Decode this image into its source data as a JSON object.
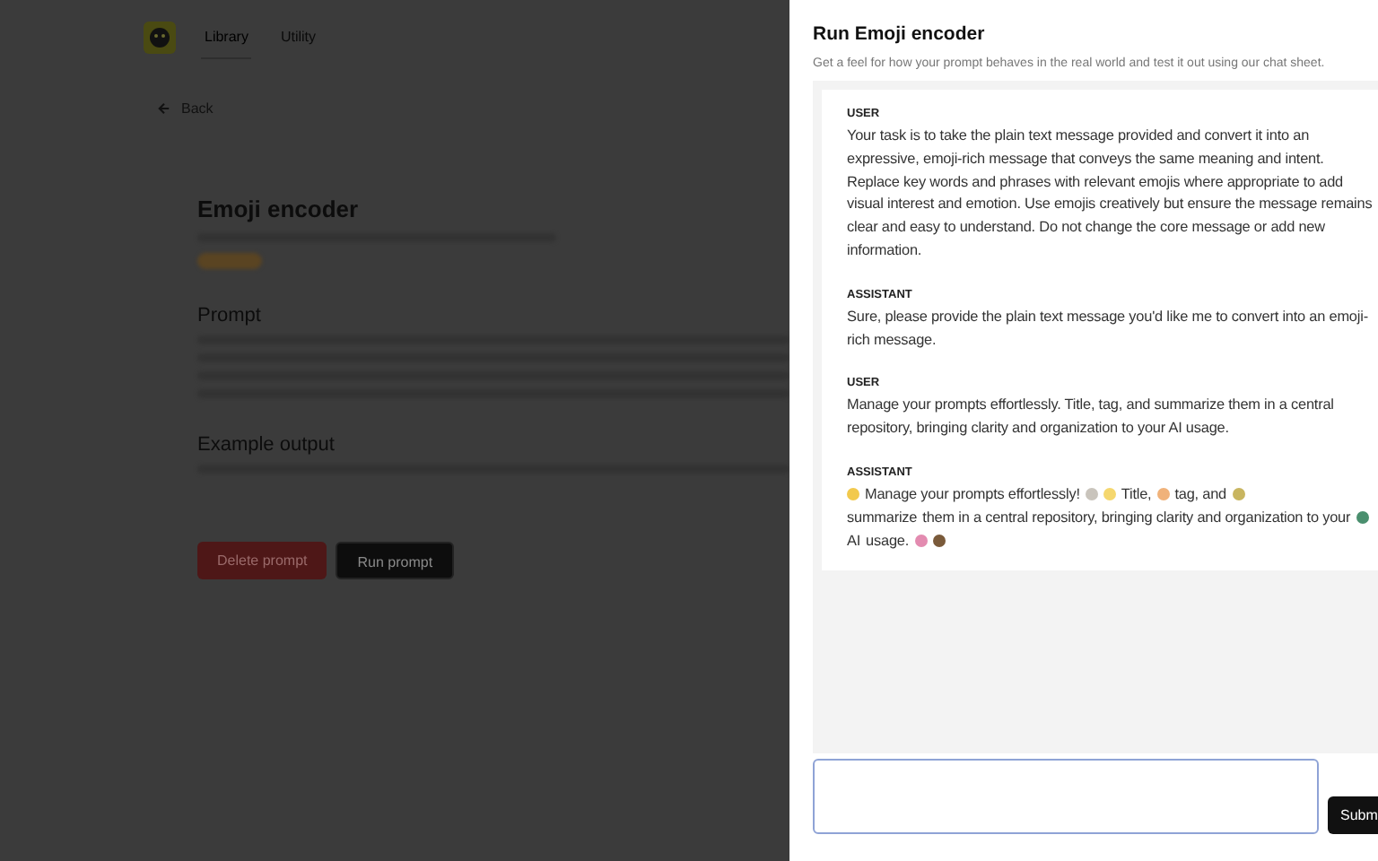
{
  "app": {
    "tabs": [
      {
        "label": "Library",
        "selected": true
      },
      {
        "label": "Utility",
        "selected": false
      }
    ],
    "back": "Back",
    "prompt_page": {
      "title": "Emoji encoder",
      "sections": [
        {
          "heading": "Prompt"
        },
        {
          "heading": "Example output"
        }
      ],
      "buttons": [
        {
          "kind": "danger",
          "label": "Delete prompt"
        },
        {
          "kind": "primary",
          "label": "Run prompt"
        }
      ]
    }
  },
  "panel": {
    "title": "Run Emoji encoder",
    "subtitle": "Get a feel for how your prompt behaves in the real world and test it out using our chat sheet.",
    "messages": [
      {
        "role": "USER",
        "parts": [
          {
            "kind": "text",
            "text": "Your task is to take the plain text message provided and convert it into an expressive, emoji-rich message that conveys the same meaning and intent. Replace key words and phrases with relevant emojis where appropriate to add visual interest and emotion. Use emojis creatively but ensure the message remains clear and easy to understand. Do not change the core message or add new information."
          }
        ]
      },
      {
        "role": "ASSISTANT",
        "parts": [
          {
            "kind": "text",
            "text": "Sure, please provide the plain text message you'd like me to convert into an emoji-rich message."
          }
        ]
      },
      {
        "role": "USER",
        "parts": [
          {
            "kind": "text",
            "text": "Manage your prompts effortlessly. Title, tag, and summarize them in a central repository, bringing clarity and organization to your AI usage."
          }
        ]
      },
      {
        "role": "ASSISTANT",
        "parts": [
          {
            "kind": "emoji",
            "color": "#f2c94c"
          },
          {
            "kind": "text",
            "text": "Manage your prompts effortlessly!"
          },
          {
            "kind": "emoji",
            "color": "#c9c4bc"
          },
          {
            "kind": "emoji",
            "color": "#f5d76e"
          },
          {
            "kind": "text",
            "text": "Title,"
          },
          {
            "kind": "emoji",
            "color": "#f0b27a"
          },
          {
            "kind": "text",
            "text": "tag, and"
          },
          {
            "kind": "emoji",
            "color": "#c8b560"
          },
          {
            "kind": "text",
            "text": "summarize"
          },
          {
            "kind": "text",
            "text": "them in a central repository, bringing clarity and organization to your"
          },
          {
            "kind": "emoji",
            "color": "#4a8f6e"
          },
          {
            "kind": "text",
            "text": "AI"
          },
          {
            "kind": "text",
            "text": "usage."
          },
          {
            "kind": "emoji",
            "color": "#e38bb0"
          },
          {
            "kind": "emoji",
            "color": "#7a5a3a"
          }
        ]
      }
    ],
    "submit": "Subm"
  }
}
